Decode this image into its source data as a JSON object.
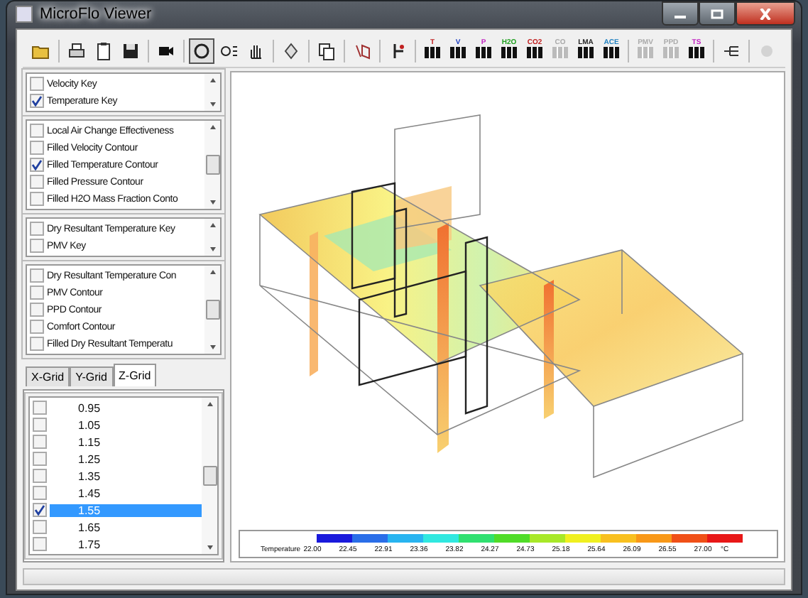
{
  "window": {
    "title": "MicroFlo Viewer"
  },
  "toolbar": {
    "view_tools": [
      {
        "selected": true
      },
      {
        "selected": false
      },
      {
        "selected": false
      }
    ],
    "grid_buttons": [
      {
        "label": "T",
        "disabled": false
      },
      {
        "label": "V",
        "disabled": false
      },
      {
        "label": "P",
        "disabled": false
      },
      {
        "label": "H2O",
        "disabled": false
      },
      {
        "label": "CO2",
        "disabled": false
      },
      {
        "label": "CO",
        "disabled": true
      },
      {
        "label": "LMA",
        "disabled": false
      },
      {
        "label": "ACE",
        "disabled": false
      }
    ],
    "comfort_buttons": [
      {
        "label": "PMV",
        "disabled": true
      },
      {
        "label": "PPD",
        "disabled": true
      },
      {
        "label": "TS",
        "disabled": false
      }
    ]
  },
  "lists": [
    {
      "items": [
        {
          "label": "Velocity Key",
          "checked": false
        },
        {
          "label": "Temperature Key",
          "checked": true
        }
      ]
    },
    {
      "items": [
        {
          "label": "Local Air Change Effectiveness",
          "checked": false
        },
        {
          "label": "Filled Velocity Contour",
          "checked": false
        },
        {
          "label": "Filled Temperature Contour",
          "checked": true
        },
        {
          "label": "Filled Pressure Contour",
          "checked": false
        },
        {
          "label": "Filled H2O Mass Fraction Conto",
          "checked": false
        }
      ]
    },
    {
      "items": [
        {
          "label": "Dry Resultant Temperature Key",
          "checked": false
        },
        {
          "label": "PMV Key",
          "checked": false
        }
      ]
    },
    {
      "items": [
        {
          "label": "Dry Resultant Temperature Con",
          "checked": false
        },
        {
          "label": "PMV Contour",
          "checked": false
        },
        {
          "label": "PPD Contour",
          "checked": false
        },
        {
          "label": "Comfort Contour",
          "checked": false
        },
        {
          "label": "Filled Dry Resultant Temperatu",
          "checked": false
        }
      ]
    }
  ],
  "grid_tabs": [
    {
      "label": "X-Grid",
      "selected": false
    },
    {
      "label": "Y-Grid",
      "selected": false
    },
    {
      "label": "Z-Grid",
      "selected": true
    }
  ],
  "grid_values": [
    {
      "label": "0.95",
      "checked": false,
      "selected": false
    },
    {
      "label": "1.05",
      "checked": false,
      "selected": false
    },
    {
      "label": "1.15",
      "checked": false,
      "selected": false
    },
    {
      "label": "1.25",
      "checked": false,
      "selected": false
    },
    {
      "label": "1.35",
      "checked": false,
      "selected": false
    },
    {
      "label": "1.45",
      "checked": false,
      "selected": false
    },
    {
      "label": "1.55",
      "checked": true,
      "selected": true
    },
    {
      "label": "1.65",
      "checked": false,
      "selected": false
    },
    {
      "label": "1.75",
      "checked": false,
      "selected": false
    }
  ],
  "legend": {
    "title": "Temperature",
    "unit": "°C",
    "bands": [
      {
        "label": "22.00",
        "color": "#1a1adc"
      },
      {
        "label": "22.45",
        "color": "#2a6ee8"
      },
      {
        "label": "22.91",
        "color": "#28b4f0"
      },
      {
        "label": "23.36",
        "color": "#30e8e0"
      },
      {
        "label": "23.82",
        "color": "#30e070"
      },
      {
        "label": "24.27",
        "color": "#50dc28"
      },
      {
        "label": "24.73",
        "color": "#a8e828"
      },
      {
        "label": "25.18",
        "color": "#f0f020"
      },
      {
        "label": "25.64",
        "color": "#f8c020"
      },
      {
        "label": "26.09",
        "color": "#f89818"
      },
      {
        "label": "26.55",
        "color": "#f05018"
      },
      {
        "label": "27.00",
        "color": "#e81818"
      }
    ]
  }
}
